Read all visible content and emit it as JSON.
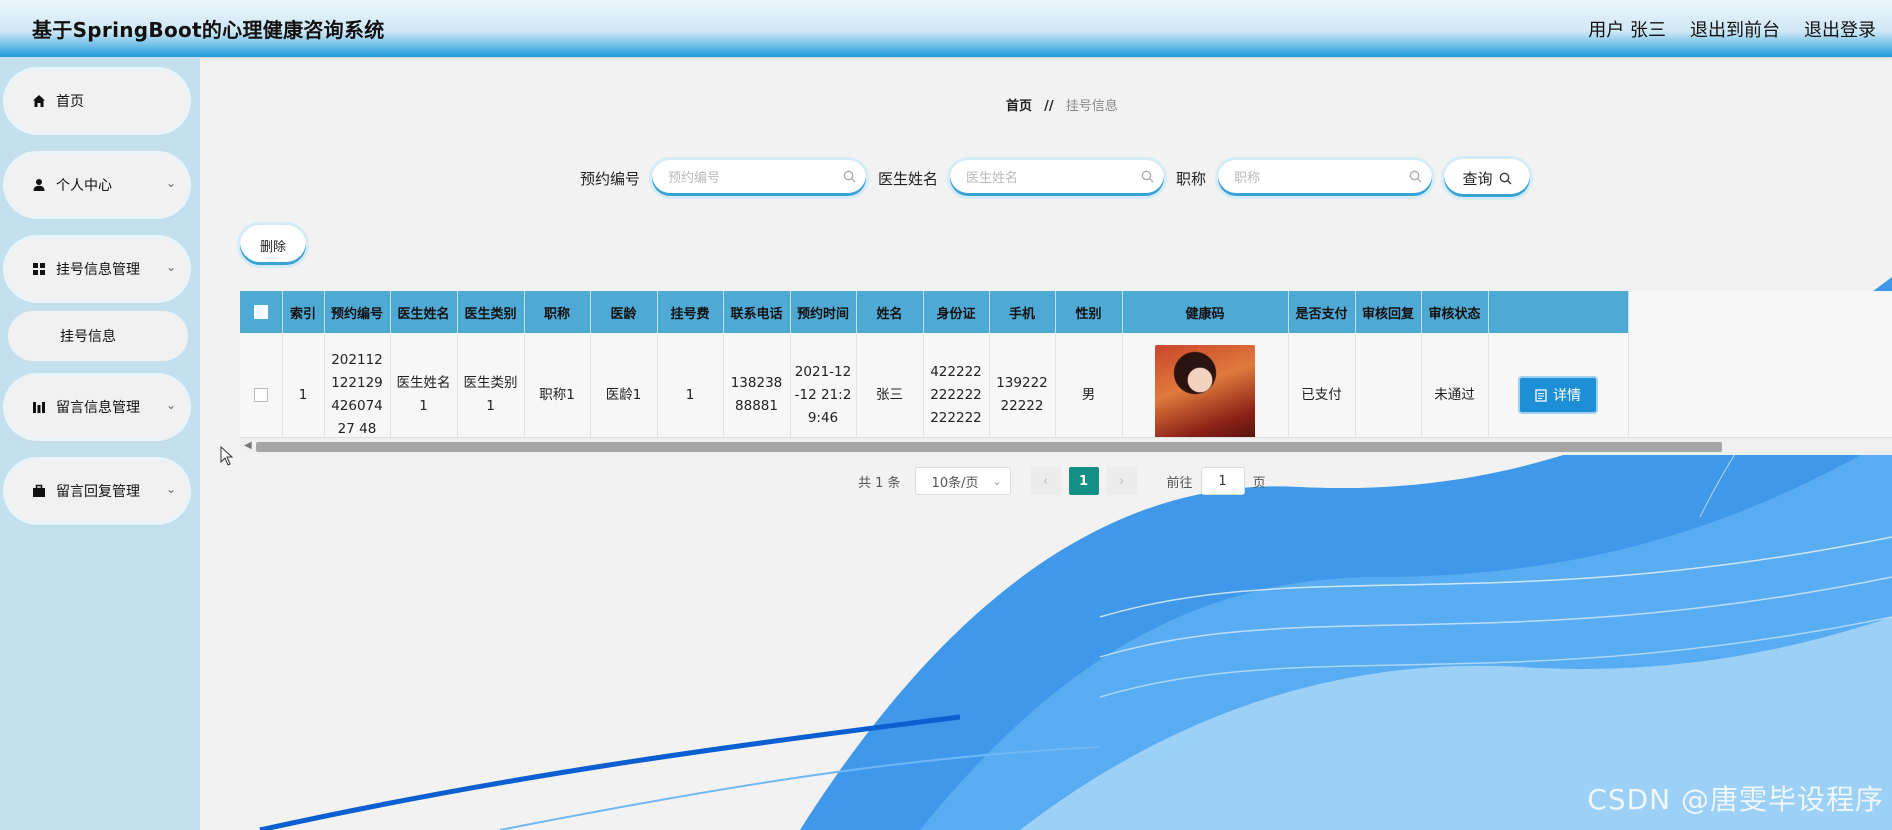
{
  "header": {
    "title": "基于SpringBoot的心理健康咨询系统",
    "user": "用户 张三",
    "to_front": "退出到前台",
    "logout": "退出登录"
  },
  "sidebar": {
    "items": [
      {
        "label": "首页",
        "icon": "home-icon"
      },
      {
        "label": "个人中心",
        "icon": "user-icon"
      },
      {
        "label": "挂号信息管理",
        "icon": "grid-icon"
      },
      {
        "label": "挂号信息",
        "icon": ""
      },
      {
        "label": "留言信息管理",
        "icon": "chart-icon"
      },
      {
        "label": "留言回复管理",
        "icon": "briefcase-icon"
      }
    ]
  },
  "breadcrumb": {
    "home": "首页",
    "sep": "//",
    "current": "挂号信息"
  },
  "search": {
    "fields": [
      {
        "label": "预约编号",
        "placeholder": "预约编号"
      },
      {
        "label": "医生姓名",
        "placeholder": "医生姓名"
      },
      {
        "label": "职称",
        "placeholder": "职称"
      }
    ],
    "query_label": "查询"
  },
  "toolbar": {
    "delete_label": "删除"
  },
  "table": {
    "columns": [
      "索引",
      "预约编号",
      "医生姓名",
      "医生类别",
      "职称",
      "医龄",
      "挂号费",
      "联系电话",
      "预约时间",
      "姓名",
      "身份证",
      "手机",
      "性别",
      "健康码",
      "是否支付",
      "审核回复",
      "审核状态",
      ""
    ],
    "rows": [
      {
        "index": "1",
        "appt_no": "20211212212942607427 48",
        "doctor_name": "医生姓名1",
        "doctor_type": "医生类别1",
        "title": "职称1",
        "years": "医龄1",
        "fee": "1",
        "phone": "13823888881",
        "appt_time": "2021-12-12 21:29:46",
        "name": "张三",
        "id_card": "422222222222222222",
        "mobile": "13922222222",
        "gender": "男",
        "health_code": "photo",
        "paid": "已支付",
        "reply": "",
        "status": "未通过",
        "action": "详情"
      }
    ]
  },
  "pagination": {
    "total": "共 1 条",
    "page_size": "10条/页",
    "current": "1",
    "goto_prefix": "前往",
    "goto_value": "1",
    "goto_suffix": "页"
  },
  "watermark": "CSDN @唐雯毕设程序",
  "colors": {
    "accent": "#1f9bdc",
    "table_header": "#4fa9d5",
    "page_active": "#148f85",
    "sidebar_bg": "#c4e0ee"
  }
}
